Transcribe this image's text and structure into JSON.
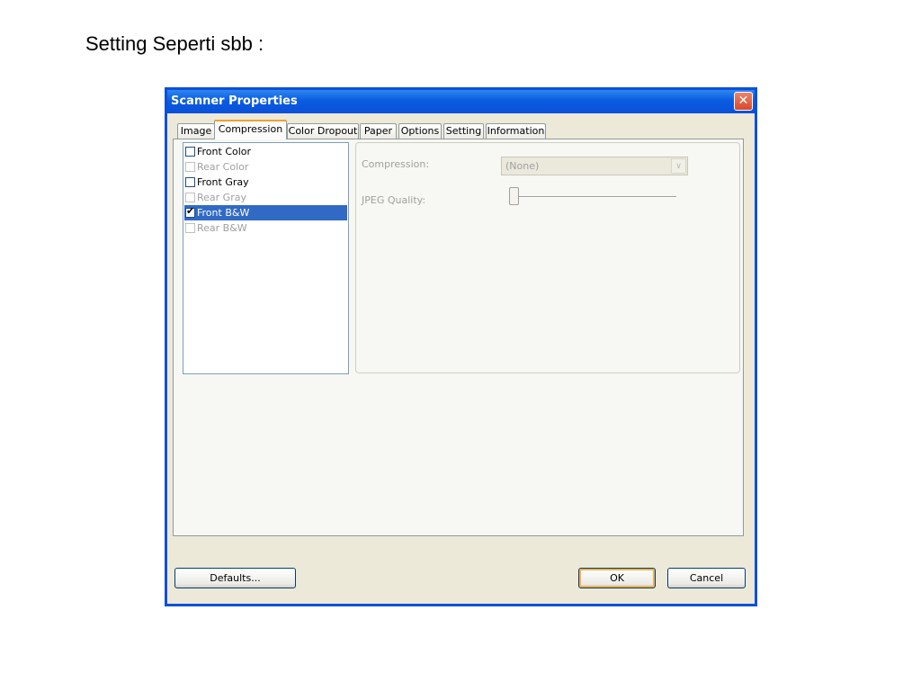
{
  "slide": {
    "heading": "Setting Seperti sbb :"
  },
  "dialog": {
    "title": "Scanner Properties",
    "close_symbol": "✕",
    "tabs": [
      {
        "label": "Image"
      },
      {
        "label": "Compression"
      },
      {
        "label": "Color Dropout"
      },
      {
        "label": "Paper"
      },
      {
        "label": "Options"
      },
      {
        "label": "Setting"
      },
      {
        "label": "Information"
      }
    ],
    "active_tab": "Compression",
    "list_items": [
      {
        "label": "Front Color",
        "checked": false,
        "enabled": true,
        "selected": false
      },
      {
        "label": "Rear Color",
        "checked": false,
        "enabled": false,
        "selected": false
      },
      {
        "label": "Front Gray",
        "checked": false,
        "enabled": true,
        "selected": false
      },
      {
        "label": "Rear Gray",
        "checked": false,
        "enabled": false,
        "selected": false
      },
      {
        "label": "Front B&W",
        "checked": true,
        "enabled": true,
        "selected": true
      },
      {
        "label": "Rear B&W",
        "checked": false,
        "enabled": false,
        "selected": false
      }
    ],
    "compression": {
      "label": "Compression:",
      "value": "(None)",
      "arrow": "∨"
    },
    "jpeg_quality": {
      "label": "JPEG Quality:",
      "value": 0
    },
    "buttons": {
      "defaults": "Defaults...",
      "ok": "OK",
      "cancel": "Cancel"
    },
    "colors": {
      "title_bar": "#0a50d8",
      "selection": "#316ac5",
      "face": "#ece9d8"
    }
  }
}
